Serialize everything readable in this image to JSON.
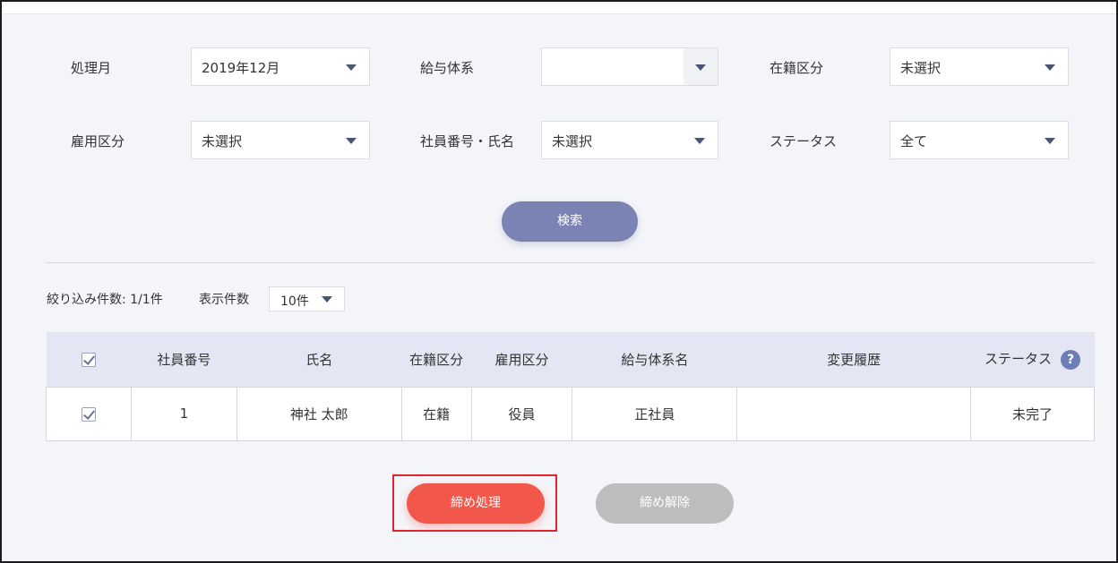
{
  "filters": {
    "processing_month": {
      "label": "処理月",
      "value": "2019年12月"
    },
    "pay_system": {
      "label": "給与体系",
      "value": ""
    },
    "enrollment": {
      "label": "在籍区分",
      "value": "未選択"
    },
    "employment": {
      "label": "雇用区分",
      "value": "未選択"
    },
    "employee": {
      "label": "社員番号・氏名",
      "value": "未選択"
    },
    "status": {
      "label": "ステータス",
      "value": "全て"
    }
  },
  "search_label": "検索",
  "results": {
    "count_text": "絞り込み件数: 1/1件",
    "per_page_label": "表示件数",
    "per_page_value": "10件"
  },
  "table": {
    "headers": [
      "社員番号",
      "氏名",
      "在籍区分",
      "雇用区分",
      "給与体系名",
      "変更履歴",
      "ステータス"
    ],
    "help_glyph": "?",
    "rows": [
      {
        "checked": true,
        "cells": [
          "1",
          "神社 太郎",
          "在籍",
          "役員",
          "正社員",
          "",
          "未完了"
        ]
      }
    ]
  },
  "actions": {
    "close_label": "締め処理",
    "unclose_label": "締め解除"
  },
  "colors": {
    "search_button": "#7a83b3",
    "close_button": "#f1574a",
    "unclose_button": "#bdbdbd",
    "highlight_border": "#e0242e",
    "header_bg": "#e4e6f3"
  },
  "icons": {
    "dropdown": "triangle-down",
    "help": "question-circle",
    "checkbox": "check"
  }
}
